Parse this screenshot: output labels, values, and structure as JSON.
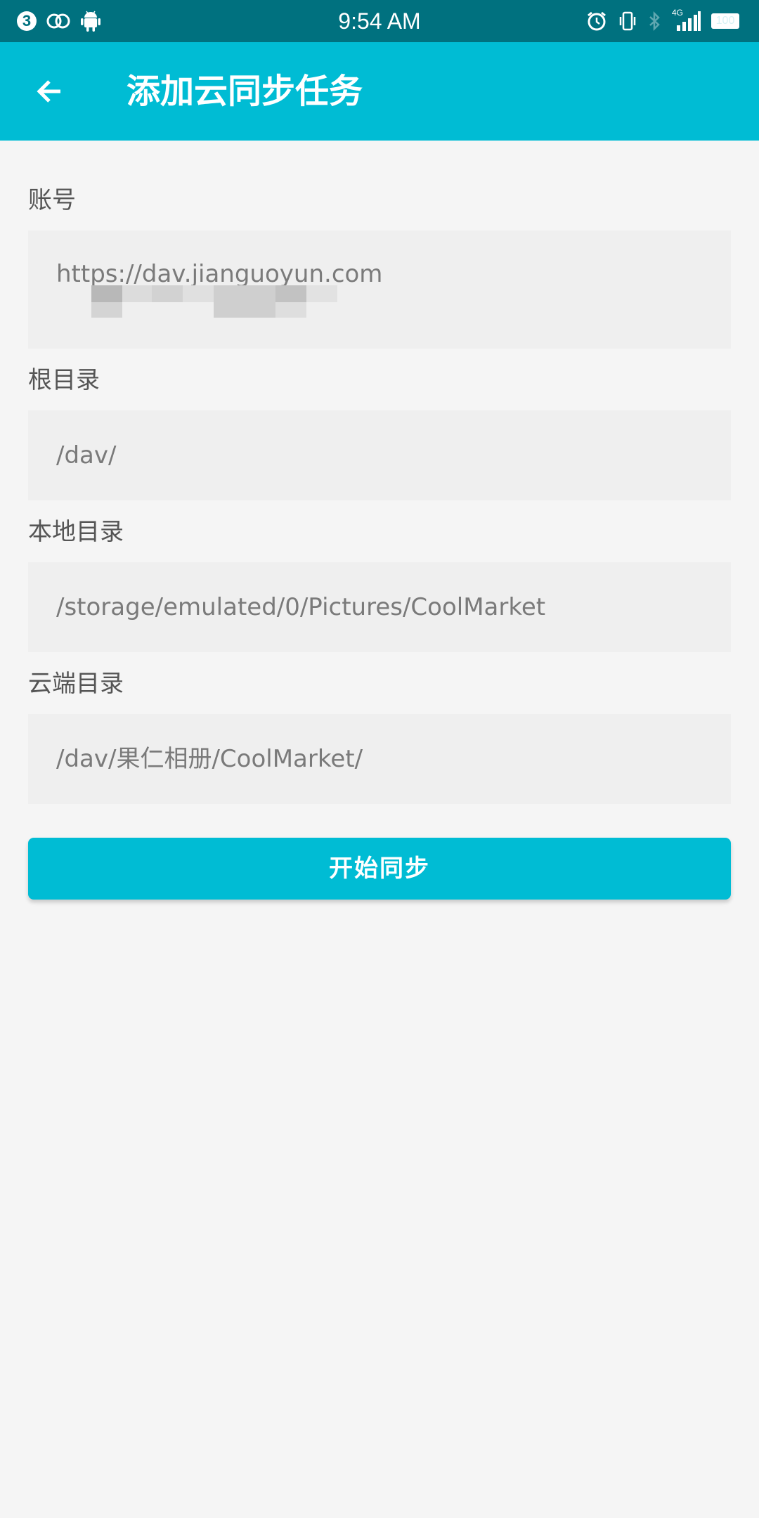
{
  "status_bar": {
    "time": "9:54 AM",
    "notification_badge": "3",
    "network_type": "4G",
    "battery": "100",
    "icons": [
      "number-badge-icon",
      "link-rings-icon",
      "android-icon",
      "alarm-icon",
      "vibrate-icon",
      "bluetooth-icon",
      "signal-icon",
      "battery-icon"
    ]
  },
  "toolbar": {
    "title": "添加云同步任务",
    "back_icon": "arrow-left-icon"
  },
  "form": {
    "account": {
      "label": "账号",
      "value": "https://dav.jianguoyun.com"
    },
    "root_dir": {
      "label": "根目录",
      "value": "/dav/"
    },
    "local_dir": {
      "label": "本地目录",
      "value": "/storage/emulated/0/Pictures/CoolMarket"
    },
    "cloud_dir": {
      "label": "云端目录",
      "value": "/dav/果仁相册/CoolMarket/"
    }
  },
  "actions": {
    "start_sync_label": "开始同步"
  },
  "colors": {
    "status_bar": "#00717f",
    "accent": "#00bcd4",
    "background": "#f5f5f5",
    "field_background": "#efefef",
    "label_text": "#555555",
    "value_text": "#7a7a7a"
  }
}
